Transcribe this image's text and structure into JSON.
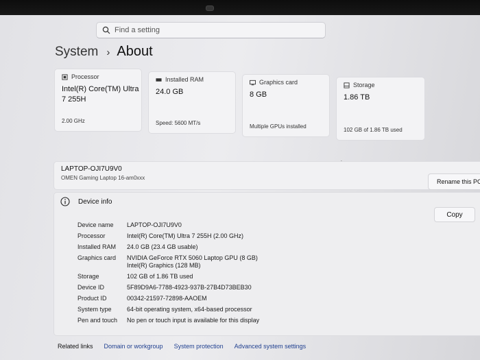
{
  "search": {
    "placeholder": "Find a setting"
  },
  "breadcrumb": {
    "parent": "System",
    "separator": "›",
    "current": "About"
  },
  "cards": [
    {
      "icon": "processor-icon",
      "label": "Processor",
      "value": "Intel(R) Core(TM) Ultra 7 255H",
      "sub": "2.00 GHz"
    },
    {
      "icon": "ram-icon",
      "label": "Installed RAM",
      "value": "24.0 GB",
      "sub": "Speed: 5600 MT/s"
    },
    {
      "icon": "graphics-card-icon",
      "label": "Graphics card",
      "value": "8 GB",
      "sub": "Multiple GPUs installed"
    },
    {
      "icon": "storage-icon",
      "label": "Storage",
      "value": "1.86 TB",
      "sub": "102 GB of 1.86 TB used"
    }
  ],
  "device": {
    "hostname": "LAPTOP-OJI7U9V0",
    "model": "OMEN Gaming Laptop 16-am0xxx",
    "rename_label": "Rename this PC"
  },
  "device_info": {
    "title": "Device info",
    "copy_label": "Copy",
    "rows": [
      {
        "key": "Device name",
        "value": "LAPTOP-OJI7U9V0"
      },
      {
        "key": "Processor",
        "value": "Intel(R) Core(TM) Ultra 7 255H (2.00 GHz)"
      },
      {
        "key": "Installed RAM",
        "value": "24.0 GB (23.4 GB usable)"
      },
      {
        "key": "Graphics card",
        "value": "NVIDIA GeForce RTX 5060 Laptop GPU (8 GB)",
        "value2": "Intel(R) Graphics (128 MB)"
      },
      {
        "key": "Storage",
        "value": "102 GB of 1.86 TB used"
      },
      {
        "key": "Device ID",
        "value": "5F89D9A6-7788-4923-937B-27B4D73BEB30"
      },
      {
        "key": "Product ID",
        "value": "00342-21597-72898-AAOEM"
      },
      {
        "key": "System type",
        "value": "64-bit operating system, x64-based processor"
      },
      {
        "key": "Pen and touch",
        "value": "No pen or touch input is available for this display"
      }
    ]
  },
  "related": {
    "title": "Related links",
    "links": [
      "Domain or workgroup",
      "System protection",
      "Advanced system settings"
    ]
  }
}
